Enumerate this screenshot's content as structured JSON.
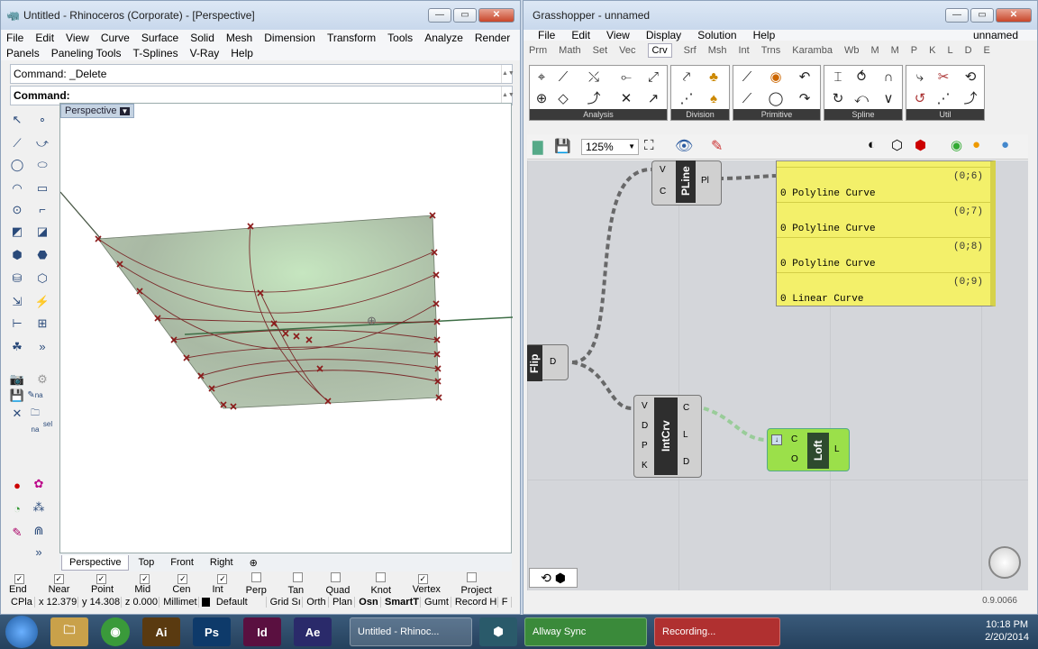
{
  "rhino": {
    "title": "Untitled - Rhinoceros (Corporate) - [Perspective]",
    "menu1": [
      "File",
      "Edit",
      "View",
      "Curve",
      "Surface",
      "Solid",
      "Mesh",
      "Dimension",
      "Transform",
      "Tools",
      "Analyze",
      "Render"
    ],
    "menu2": [
      "Panels",
      "Paneling Tools",
      "T-Splines",
      "V-Ray",
      "Help"
    ],
    "cmd_history": "Command: _Delete",
    "cmd_prompt": "Command:",
    "viewport_label": "Perspective",
    "vp_tabs": [
      "Perspective",
      "Top",
      "Front",
      "Right"
    ],
    "osnaps": [
      {
        "label": "End",
        "checked": true
      },
      {
        "label": "Near",
        "checked": true
      },
      {
        "label": "Point",
        "checked": true
      },
      {
        "label": "Mid",
        "checked": true
      },
      {
        "label": "Cen",
        "checked": true
      },
      {
        "label": "Int",
        "checked": true
      },
      {
        "label": "Perp",
        "checked": false
      },
      {
        "label": "Tan",
        "checked": false
      },
      {
        "label": "Quad",
        "checked": false
      },
      {
        "label": "Knot",
        "checked": false
      },
      {
        "label": "Vertex",
        "checked": true
      },
      {
        "label": "Project",
        "checked": false
      }
    ],
    "status": {
      "cplane": "CPla",
      "x": "x 12.379",
      "y": "y 14.308",
      "z": "z 0.000",
      "units": "Millimet",
      "layer": "Default",
      "grid": "Grid Sı",
      "ortho": "Orth",
      "planar": "Plan",
      "osnap": "Osn",
      "smarttrack": "SmartT",
      "gumball": "Gumt",
      "record": "Record H",
      "filter": "F"
    },
    "side_labels": [
      "na",
      "na",
      "sel"
    ]
  },
  "gh": {
    "title": "Grasshopper - unnamed",
    "doc": "unnamed",
    "menu": [
      "File",
      "Edit",
      "View",
      "Display",
      "Solution",
      "Help"
    ],
    "tabs": [
      "Prm",
      "Math",
      "Set",
      "Vec",
      "Crv",
      "Srf",
      "Msh",
      "Int",
      "Trns",
      "Karamba",
      "Wb",
      "M",
      "M",
      "P",
      "K",
      "L",
      "D",
      "E"
    ],
    "active_tab": "Crv",
    "groups": [
      "Analysis",
      "Division",
      "Primitive",
      "Spline",
      "Util"
    ],
    "zoom": "125%",
    "panel_rows": [
      {
        "idx": "(0;6)",
        "val": "0 Polyline Curve"
      },
      {
        "idx": "(0;7)",
        "val": "0 Polyline Curve"
      },
      {
        "idx": "(0;8)",
        "val": "0 Polyline Curve"
      },
      {
        "idx": "(0;9)",
        "val": "0 Linear Curve"
      }
    ],
    "pline": {
      "name": "PLine",
      "in": [
        "V",
        "C"
      ],
      "out": "Pl"
    },
    "flip": {
      "name": "Flip",
      "out": "D"
    },
    "intcrv": {
      "name": "IntCrv",
      "in": [
        "V",
        "D",
        "P",
        "K"
      ],
      "out": [
        "C",
        "L",
        "D"
      ]
    },
    "loft": {
      "name": "Loft",
      "in": [
        "C",
        "O"
      ],
      "out": "L"
    },
    "version": "0.9.0066"
  },
  "taskbar": {
    "apps": [
      {
        "label": "Ai",
        "color": "#5a3a10"
      },
      {
        "label": "Ps",
        "color": "#0e3a6a"
      },
      {
        "label": "Id",
        "color": "#5a1040"
      },
      {
        "label": "Ae",
        "color": "#2a2a6a"
      }
    ],
    "windows": [
      {
        "label": "Untitled - Rhinoc..."
      },
      {
        "label": "Allway Sync"
      },
      {
        "label": "Recording..."
      }
    ],
    "time": "10:18 PM",
    "date": "2/20/2014"
  }
}
